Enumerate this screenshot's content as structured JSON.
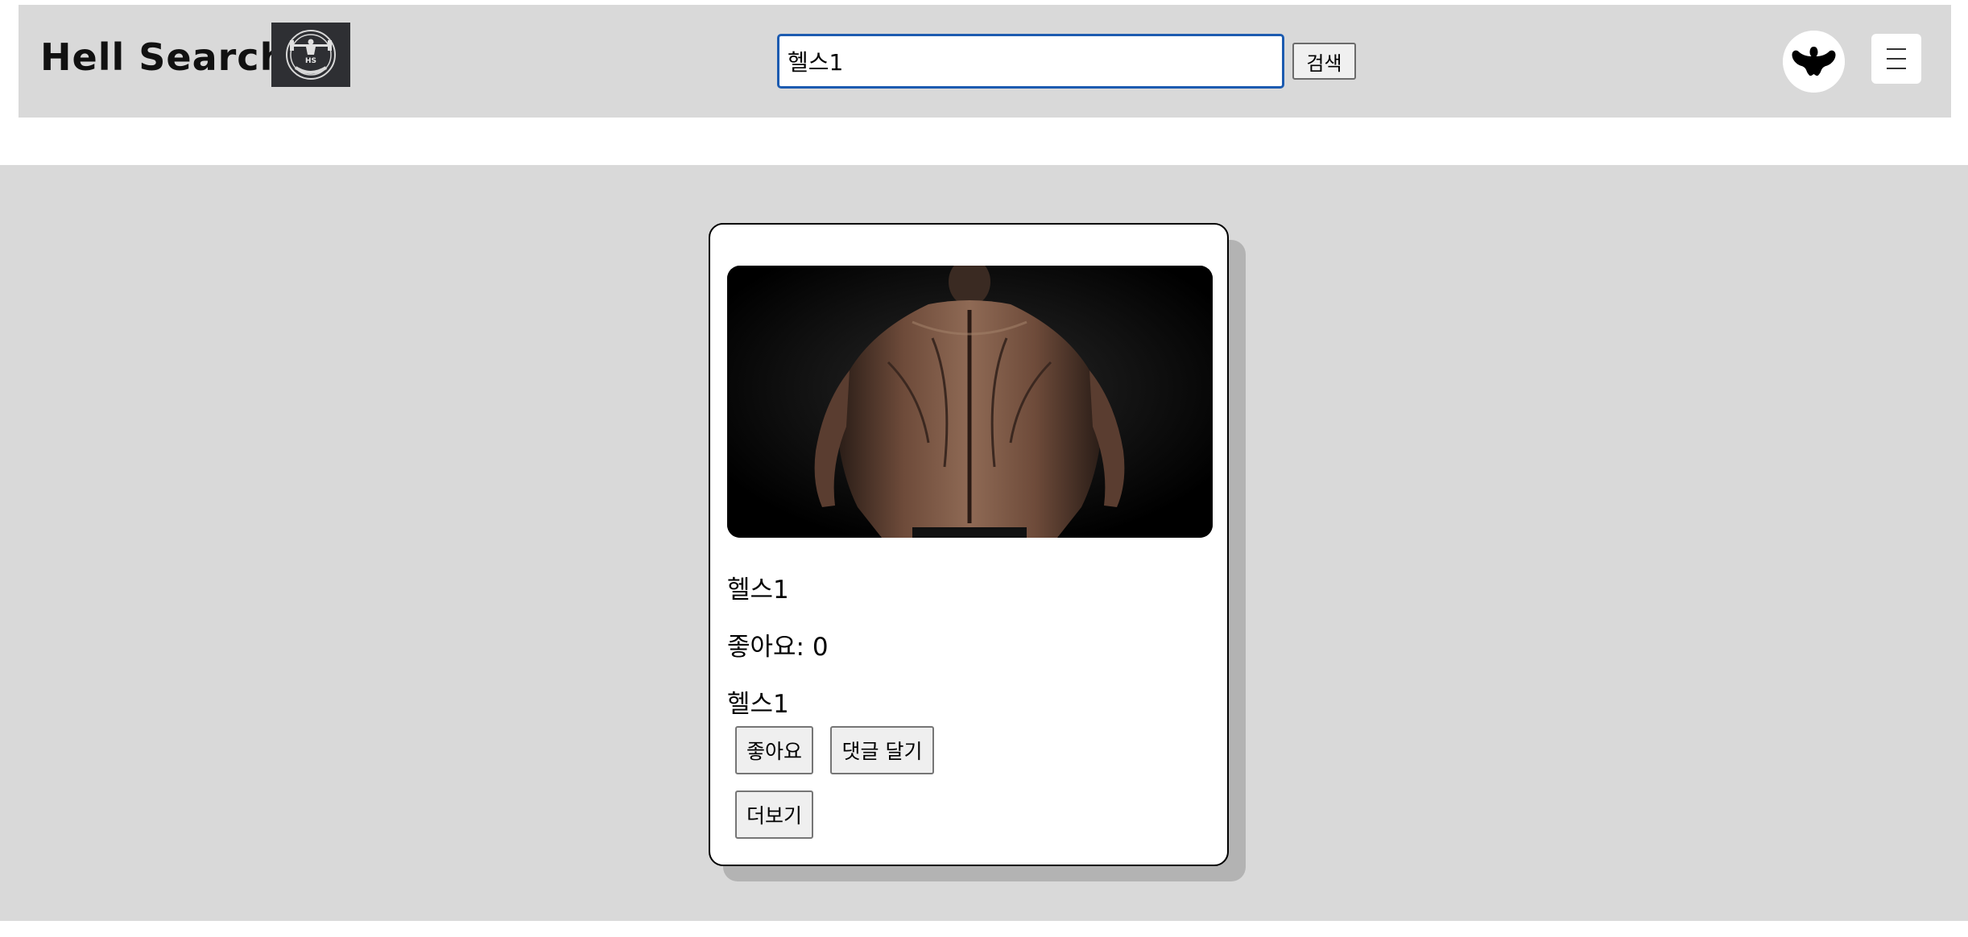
{
  "header": {
    "brand_title": "Hell Search",
    "logo_icon": "hs-barbell-logo-icon",
    "search": {
      "value": "헬스1",
      "placeholder": ""
    },
    "search_button_label": "검색",
    "avatar_icon": "muscle-silhouette-icon",
    "menu_icon": "hamburger-menu-icon"
  },
  "post": {
    "image_icon": "muscular-back-photo",
    "title": "헬스1",
    "likes_text": "좋아요: 0",
    "content": "헬스1",
    "like_button_label": "좋아요",
    "comment_button_label": "댓글 달기",
    "more_button_label": "더보기"
  },
  "colors": {
    "header_bg": "#d9d9d9",
    "main_bg": "#d9d9d9",
    "search_border": "#1c5bb0",
    "card_bg": "#ffffff",
    "card_shadow": "#b3b3b3"
  }
}
